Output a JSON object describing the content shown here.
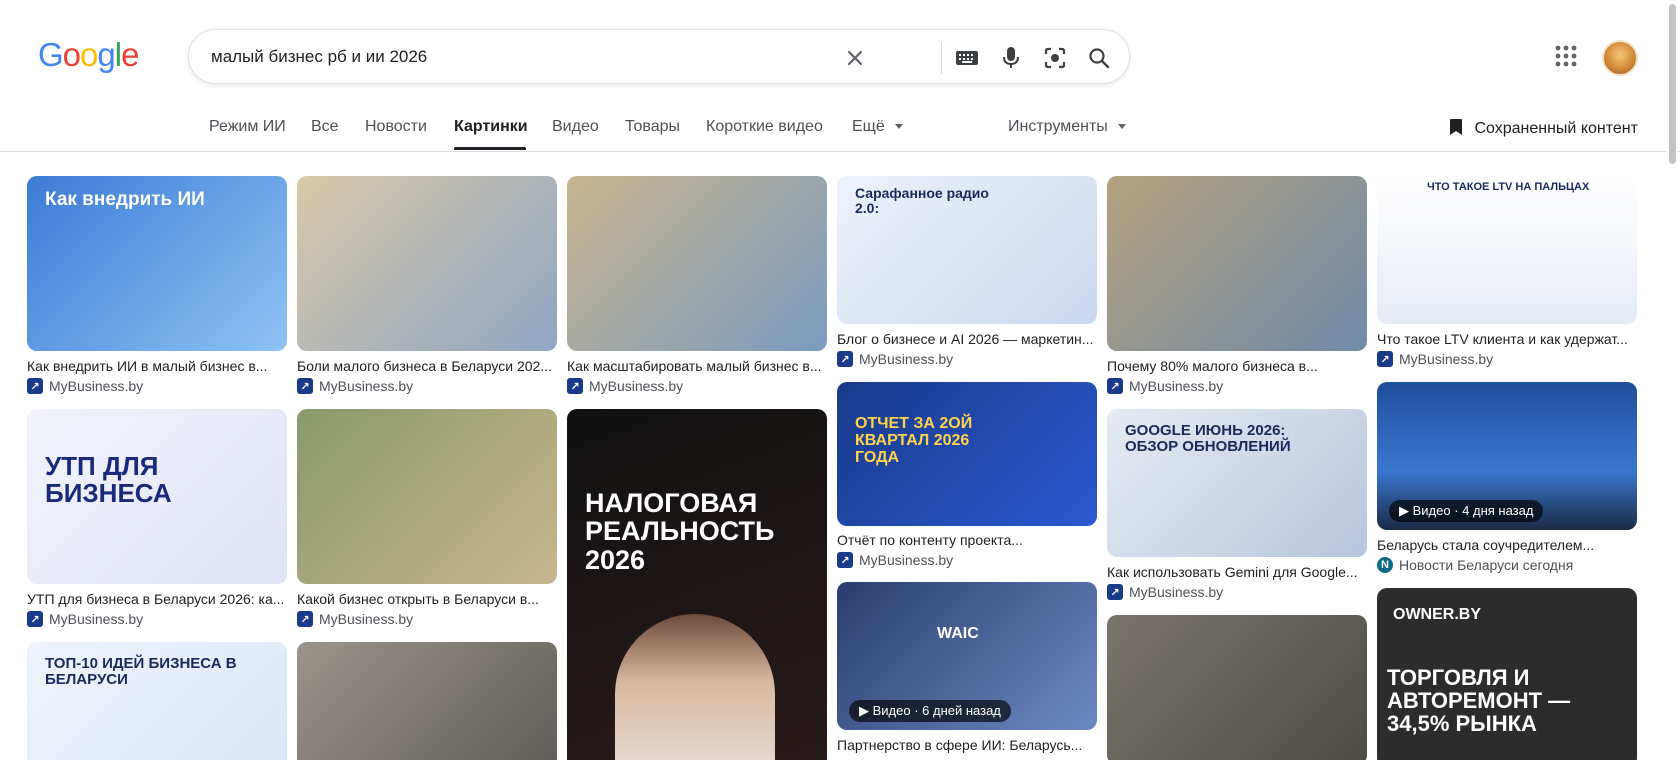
{
  "logo": {
    "letters": [
      "G",
      "o",
      "o",
      "g",
      "l",
      "e"
    ],
    "colors": [
      "#4285F4",
      "#EA4335",
      "#FBBC05",
      "#4285F4",
      "#34A853",
      "#EA4335"
    ]
  },
  "search": {
    "query": "малый бизнес рб и ии 2026"
  },
  "tabs": [
    {
      "label": "Режим ИИ"
    },
    {
      "label": "Все"
    },
    {
      "label": "Новости"
    },
    {
      "label": "Картинки"
    },
    {
      "label": "Видео"
    },
    {
      "label": "Товары"
    },
    {
      "label": "Короткие видео"
    },
    {
      "label": "Ещё"
    },
    {
      "label": "Инструменты"
    }
  ],
  "saved_label": "Сохраненный контент",
  "results": [
    {
      "caption": "Как внедрить ИИ в малый бизнес в...",
      "source": "MyBusiness.by",
      "thumb_text": "Как внедрить ИИ",
      "bg": "#3b7bd4"
    },
    {
      "caption": "Боли малого бизнеса в Беларуси 202...",
      "source": "MyBusiness.by",
      "thumb_text": "",
      "bg": "#c9b79a"
    },
    {
      "caption": "Как масштабировать малый бизнес в...",
      "source": "MyBusiness.by",
      "thumb_text": "",
      "bg": "#b9a98c"
    },
    {
      "caption": "Блог о бизнесе и AI 2026 — маркетин...",
      "source": "MyBusiness.by",
      "thumb_text": "Сарафанное радио 2.0:",
      "bg": "#e8eef8"
    },
    {
      "caption": "Почему 80% малого бизнеса в...",
      "source": "MyBusiness.by",
      "thumb_text": "",
      "bg": "#a79474"
    },
    {
      "caption": "Что такое LTV клиента и как удержат...",
      "source": "MyBusiness.by",
      "thumb_text": "ЧТО ТАКОЕ LTV НА ПАЛЬЦАХ",
      "bg": "#f2f4f8"
    },
    {
      "caption": "УТП для бизнеса в Беларуси 2026: ка...",
      "source": "MyBusiness.by",
      "thumb_text": "УТП ДЛЯ БИЗНЕСА",
      "bg": "#eef0fb"
    },
    {
      "caption": "Какой бизнес открыть в Беларуси в...",
      "source": "MyBusiness.by",
      "thumb_text": "",
      "bg": "#7b8a5a"
    },
    {
      "caption": "",
      "source": "",
      "thumb_text": "НАЛОГОВАЯ РЕАЛЬНОСТЬ 2026",
      "bg": "#111111"
    },
    {
      "caption": "Отчёт по контенту проекта...",
      "source": "MyBusiness.by",
      "thumb_text": "ОТЧЕТ ЗА 2ОЙ КВАРТАЛ 2026 ГОДА",
      "bg": "#1a3a8a"
    },
    {
      "caption": "Как использовать Gemini для Google...",
      "source": "MyBusiness.by",
      "thumb_text": "GOOGLE ИЮНЬ 2026: ОБЗОР ОБНОВЛЕНИЙ",
      "bg": "#e6ebf3"
    },
    {
      "caption": "Беларусь стала соучредителем...",
      "source": "Новости Беларуси сегодня",
      "thumb_text": "",
      "bg": "#1f4e9a",
      "badge": "Видео · 4 дня назад"
    },
    {
      "caption": "",
      "source": "",
      "thumb_text": "ТОП-10 ИДЕЙ БИЗНЕСА В БЕЛАРУСИ",
      "bg": "#eaf0fa"
    },
    {
      "caption": "",
      "source": "",
      "thumb_text": "",
      "bg": "#8f8a84"
    },
    {
      "caption": "Партнерство в сфере ИИ: Беларусь...",
      "source": "",
      "thumb_text": "WAIC",
      "bg": "#2a3d6e",
      "badge": "Видео · 6 дней назад"
    },
    {
      "caption": "",
      "source": "",
      "thumb_text": "",
      "bg": "#6e6a64"
    },
    {
      "caption": "",
      "source": "",
      "thumb_text": "ТОРГОВЛЯ И АВТОРЕМОНТ — 34,5% РЫНКА",
      "bg": "#2c2c2c",
      "sub": "OWNER.BY"
    }
  ]
}
